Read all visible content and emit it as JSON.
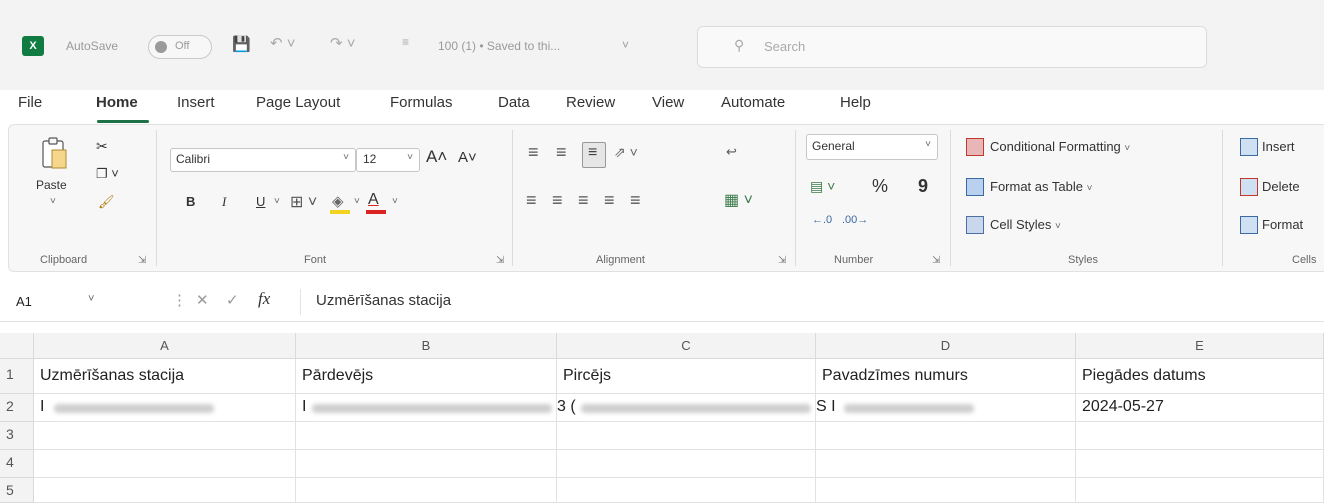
{
  "titlebar": {
    "logo": "X",
    "autosave_label": "AutoSave",
    "autosave_state": "Off",
    "file_title": "100 (1) • Saved to thi...",
    "search_placeholder": "Search"
  },
  "menu_tabs": [
    "File",
    "Home",
    "Insert",
    "Page Layout",
    "Formulas",
    "Data",
    "Review",
    "View",
    "Automate",
    "Help"
  ],
  "active_tab": "Home",
  "ribbon": {
    "clipboard": {
      "paste_label": "Paste",
      "group_label": "Clipboard"
    },
    "font": {
      "font_name": "Calibri",
      "font_size": "12",
      "bold": "B",
      "italic": "I",
      "underline": "U",
      "grow": "A˄",
      "shrink": "A˅",
      "font_color": "A",
      "group_label": "Font"
    },
    "alignment": {
      "group_label": "Alignment"
    },
    "number": {
      "format": "General",
      "percent": "%",
      "comma": "9",
      "group_label": "Number"
    },
    "styles": {
      "conditional": "Conditional Formatting",
      "format_table": "Format as Table",
      "cell_styles": "Cell Styles",
      "group_label": "Styles"
    },
    "cells": {
      "insert": "Insert",
      "delete": "Delete",
      "format": "Format",
      "group_label": "Cells"
    }
  },
  "formula_bar": {
    "name_box": "A1",
    "fx": "fx",
    "content": "Uzmērīšanas stacija"
  },
  "grid": {
    "columns": [
      "A",
      "B",
      "C",
      "D",
      "E"
    ],
    "rows": [
      "1",
      "2",
      "3",
      "4",
      "5"
    ],
    "headers": [
      "Uzmērīšanas stacija",
      "Pārdevējs",
      "Pircējs",
      "Pavadzīmes numurs",
      "Piegādes datums"
    ],
    "row2": {
      "a_prefix": "I",
      "b_prefix": "I",
      "c_prefix": "3 (",
      "d_prefix": "S I",
      "e_value": "2024-05-27"
    }
  },
  "colors": {
    "accent": "#107c41",
    "tab_underline": "#1e7145"
  }
}
